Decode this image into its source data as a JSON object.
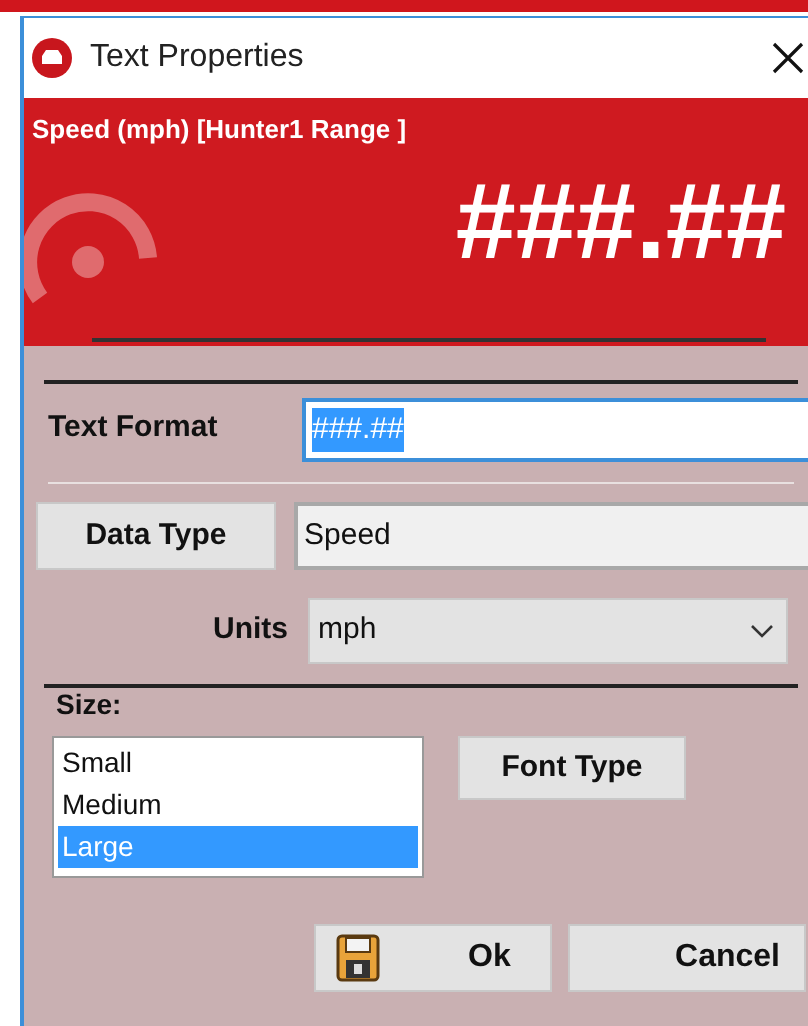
{
  "window": {
    "title": "Text Properties"
  },
  "header": {
    "label": "Speed (mph) [Hunter1 Range ]",
    "preview": "###.##"
  },
  "text_format": {
    "label": "Text Format",
    "value": "###.##",
    "selected": true
  },
  "data_type": {
    "button": "Data Type",
    "value": "Speed"
  },
  "units": {
    "label": "Units",
    "value": "mph"
  },
  "size": {
    "label": "Size:",
    "items": [
      {
        "label": "Small",
        "selected": false
      },
      {
        "label": "Medium",
        "selected": false
      },
      {
        "label": "Large",
        "selected": true
      }
    ]
  },
  "font_type_button": "Font Type",
  "buttons": [
    {
      "kind": "ok",
      "label": "Ok"
    },
    {
      "kind": "cancel",
      "label": "Cancel"
    }
  ]
}
